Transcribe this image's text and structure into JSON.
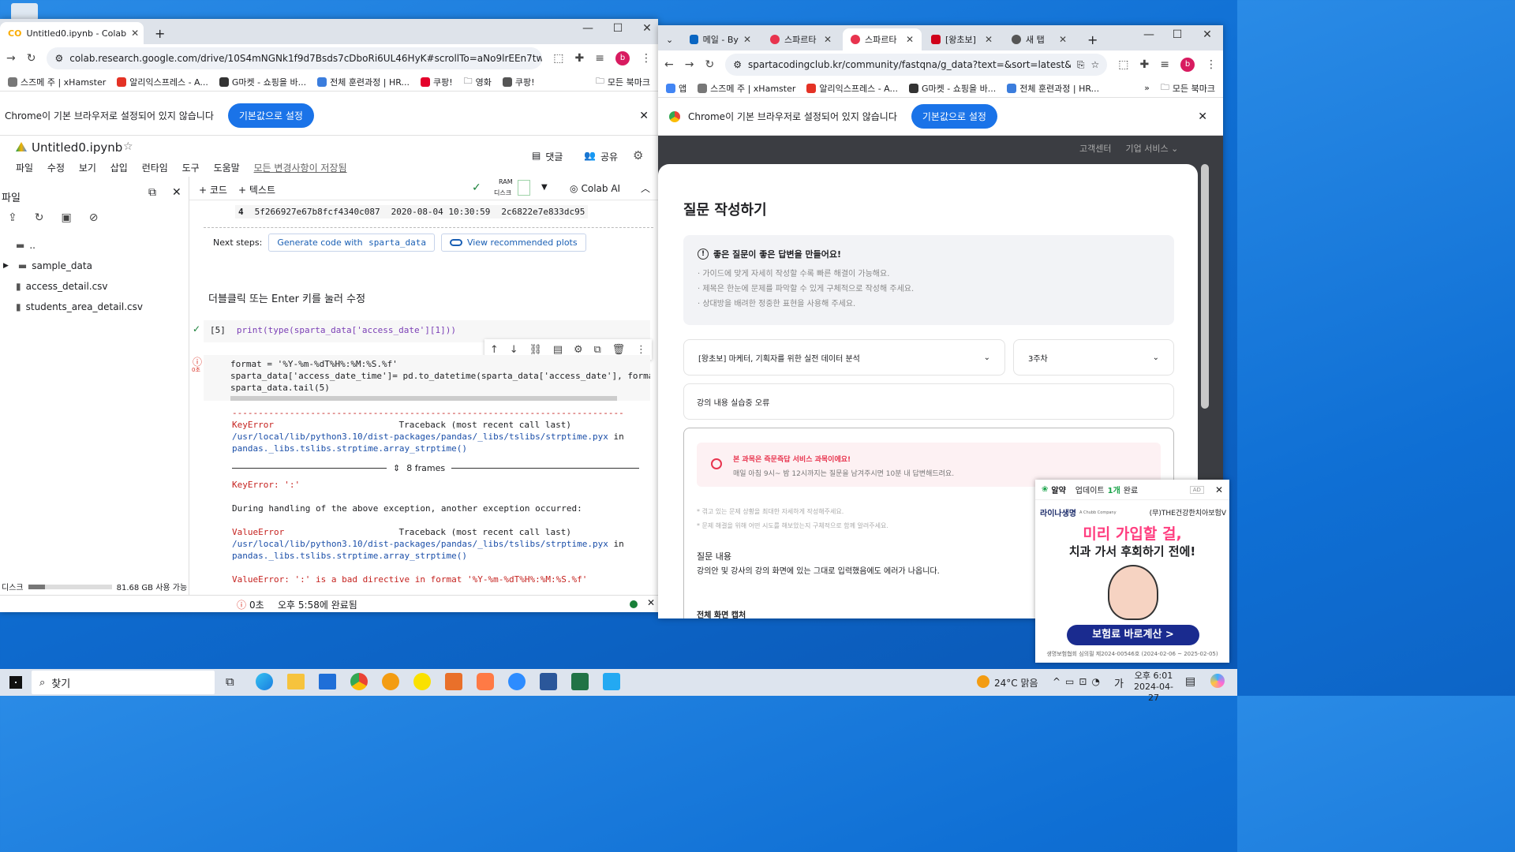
{
  "desktop": {
    "recycle_icon": "recycle-bin-icon"
  },
  "left_window": {
    "tabs": [
      {
        "label": "Untitled0.ipynb - Colab"
      }
    ],
    "new_tab": "+",
    "controls": {
      "min": "—",
      "max": "☐",
      "close": "✕"
    },
    "url": "colab.research.google.com/drive/10S4mNGNk1f9d7Bsds7cDboRi6UL46HyK#scrollTo=aNo9lrEEn7tw",
    "bookmarks": [
      {
        "label": "스즈메 주 | xHamster",
        "color": "#777"
      },
      {
        "label": "알리익스프레스 - A...",
        "color": "#e43225"
      },
      {
        "label": "G마켓 - 쇼핑을 바...",
        "color": "#333"
      },
      {
        "label": "전체 훈련과정 | HR...",
        "color": "#3b7ddd"
      },
      {
        "label": "쿠팡!",
        "color": "#e4002b"
      },
      {
        "label": "영화",
        "color": "#888"
      },
      {
        "label": "쿠팡!",
        "color": "#555"
      }
    ],
    "bookmarks_all": "모든 북마크",
    "infobar": {
      "text": "Chrome이 기본 브라우저로 설정되어 있지 않습니다",
      "button": "기본값으로 설정",
      "close": "✕"
    },
    "colab": {
      "title": "Untitled0.ipynb",
      "menu": [
        "파일",
        "수정",
        "보기",
        "삽입",
        "런타임",
        "도구",
        "도움말"
      ],
      "saved_status": "모든 변경사항이 저장됨",
      "comment": "댓글",
      "share": "공유",
      "files_title": "파일",
      "add_code": "+ 코드",
      "add_text": "+ 텍스트",
      "ram": "RAM",
      "disk": "디스크",
      "colab_ai": "Colab AI",
      "files": [
        {
          "name": "..",
          "type": "folder"
        },
        {
          "name": "sample_data",
          "type": "folder"
        },
        {
          "name": "access_detail.csv",
          "type": "file"
        },
        {
          "name": "students_area_detail.csv",
          "type": "file"
        }
      ],
      "disk_label": "디스크",
      "disk_free": "81.68 GB 사용 가능",
      "disk_used_fraction": 0.2,
      "df_row": {
        "index": "4",
        "id": "5f266927e67b8fcf4340c087",
        "date": "2020-08-04 10:30:59",
        "user": "2c6822e7e833dc95"
      },
      "next_steps": "Next steps:",
      "gen_code": "Generate code with",
      "gen_code_var": "sparta_data",
      "view_plots": "View recommended plots",
      "text_cell": "더블클릭 또는 Enter 키를 눌러 수정",
      "cell5_num": "[5]",
      "cell5_code": "print(type(sparta_data['access_date'][1]))",
      "err_cell_code": [
        "format = '%Y-%m-%dT%H%:%M:%S.%f'",
        "sparta_data['access_date_time']= pd.to_datetime(sparta_data['access_date'], format=format)",
        "sparta_data.tail(5)"
      ],
      "err_time": "0초",
      "output": {
        "sep": "---------------------------------------------------------------------------",
        "keyerror": "KeyError",
        "traceback": "Traceback (most recent call last)",
        "path": "/usr/local/lib/python3.10/dist-packages/pandas/_libs/tslibs/strptime.pyx",
        "in_word": "in",
        "func": "pandas._libs.tslibs.strptime.array_strptime()",
        "frames": "8 frames",
        "keyerror_msg": "KeyError: ':'",
        "during": "During handling of the above exception, another exception occurred:",
        "valueerror": "ValueError",
        "valueerror_msg": "ValueError: ':' is a bad directive in format '%Y-%m-%dT%H%:%M:%S.%f'"
      },
      "status": {
        "time": "0초",
        "done": "오후 5:58에 완료됨"
      }
    }
  },
  "right_window": {
    "tabs": [
      {
        "label": "메일 - By",
        "color": "#0a66c2"
      },
      {
        "label": "스파르타",
        "color": "#e8344e"
      },
      {
        "label": "스파르타",
        "color": "#e8344e"
      },
      {
        "label": "[왕초보]",
        "color": "#d0021b"
      },
      {
        "label": "새 탭",
        "color": "#555"
      }
    ],
    "url": "spartacodingclub.kr/community/fastqna/g_data?text=&sort=latest&...",
    "bookmarks": [
      {
        "label": "앱",
        "color": "#4285f4"
      },
      {
        "label": "스즈메 주 | xHamster",
        "color": "#777"
      },
      {
        "label": "알리익스프레스 - A...",
        "color": "#e43225"
      },
      {
        "label": "G마켓 - 쇼핑을 바...",
        "color": "#333"
      },
      {
        "label": "전체 훈련과정 | HR...",
        "color": "#3b7ddd"
      }
    ],
    "bookmarks_all": "모든 북마크",
    "infobar": {
      "text": "Chrome이 기본 브라우저로 설정되어 있지 않습니다",
      "button": "기본값으로 설정"
    },
    "site": {
      "header_links": [
        "고객센터",
        "기업 서비스 ⌄"
      ],
      "title": "질문 작성하기",
      "tips_title": "좋은 질문이 좋은 답변을 만들어요!",
      "tips": [
        "· 가이드에 맞게 자세히 작성할 수록 빠른 해결이 가능해요.",
        "· 제목은 한눈에 문제를 파악할 수 있게 구체적으로 작성해 주세요.",
        "· 상대방을 배려한 정중한 표현을 사용해 주세요."
      ],
      "course_select": "[왕초보] 마케터, 기획자를 위한 실전 데이터 분석",
      "week_select": "3주차",
      "question_title": "강의 내용 실습중 오류",
      "notice_title": "본 과목은 즉문즉답 서비스 과목이에요!",
      "notice_desc": "매일 아침 9시~ 밤 12시까지는 질문을 남겨주시면 10분 내 답변해드려요.",
      "hints": [
        "* 겪고 있는 문제 상황을 최대한 자세하게 작성해주세요.",
        "* 문제 해결을 위해 어떤 시도를 해보았는지 구체적으로 함께 알려주세요."
      ],
      "content_label": "질문 내용",
      "content_text": "강의안 및 강사의 강의 화면에 있는 그대로 입력했음에도 에러가 나옵니다.",
      "capture_label": "전체 화면 캡처"
    }
  },
  "ad_popup": {
    "app": "알약",
    "update_text": "업데이트",
    "count": "1개",
    "done": "완료",
    "ad": "AD",
    "brand": "라이나생명",
    "brand_sub": "A Chubb Company",
    "brand_right": "(무)THE건강한치아보험V",
    "headline1": "미리 가입할 걸,",
    "headline2": "치과 가서 후회하기 전에!",
    "cta": "보험료 바로계산 >",
    "footer": "생명보험협회 심의필 제2024-00546호 (2024-02-06 ~ 2025-02-05)"
  },
  "taskbar": {
    "search": "찾기",
    "weather": "24°C 맑음",
    "ime": "가",
    "time": "오후 6:01",
    "date": "2024-04-27"
  }
}
